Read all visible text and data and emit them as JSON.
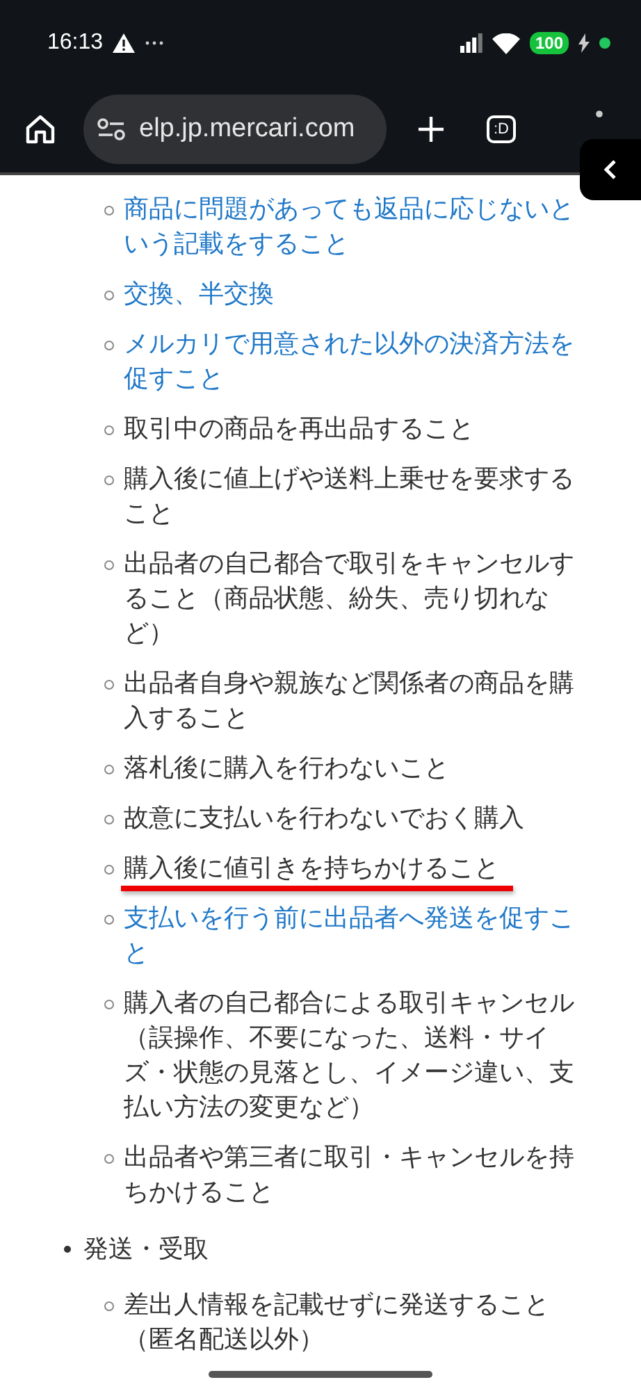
{
  "status_bar": {
    "time": "16:13",
    "battery": "100"
  },
  "toolbar": {
    "url": "elp.jp.mercari.com",
    "tab_label": ":D"
  },
  "sections": [
    {
      "children": [
        {
          "text": "商品に問題があっても返品に応じないという記載をすること",
          "link": true,
          "marked": false
        },
        {
          "text": "交換、半交換",
          "link": true,
          "marked": false
        },
        {
          "text": "メルカリで用意された以外の決済方法を促すこと",
          "link": true,
          "marked": false
        },
        {
          "text": "取引中の商品を再出品すること",
          "link": false,
          "marked": false
        },
        {
          "text": "購入後に値上げや送料上乗せを要求すること",
          "link": false,
          "marked": false
        },
        {
          "text": "出品者の自己都合で取引をキャンセルすること（商品状態、紛失、売り切れなど）",
          "link": false,
          "marked": false
        },
        {
          "text": "出品者自身や親族など関係者の商品を購入すること",
          "link": false,
          "marked": false
        },
        {
          "text": "落札後に購入を行わないこと",
          "link": false,
          "marked": false
        },
        {
          "text": "故意に支払いを行わないでおく購入",
          "link": false,
          "marked": false
        },
        {
          "text": "購入後に値引きを持ちかけること",
          "link": false,
          "marked": true
        },
        {
          "text": "支払いを行う前に出品者へ発送を促すこと",
          "link": true,
          "marked": false
        },
        {
          "text": "購入者の自己都合による取引キャンセル（誤操作、不要になった、送料・サイズ・状態の見落とし、イメージ違い、支払い方法の変更など）",
          "link": false,
          "marked": false
        },
        {
          "text": "出品者や第三者に取引・キャンセルを持ちかけること",
          "link": false,
          "marked": false
        }
      ]
    },
    {
      "title": "発送・受取",
      "children": [
        {
          "text": "差出人情報を記載せずに発送すること（匿名配送以外）",
          "link": false,
          "marked": false
        }
      ]
    }
  ]
}
